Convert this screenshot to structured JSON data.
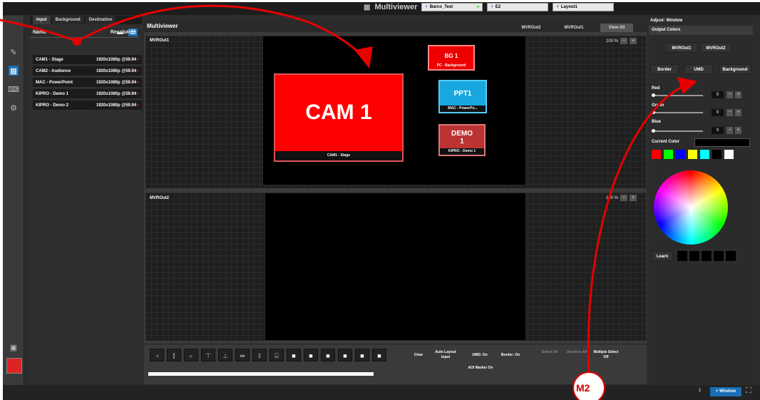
{
  "app": {
    "title": "Multiviewer",
    "destination_preset": "Barco_Test",
    "system": "E2",
    "layout": "Layout1"
  },
  "left_panel": {
    "tabs": [
      "Input",
      "Background",
      "Destination"
    ],
    "header_name": "Name",
    "header_resolution": "Resolution",
    "rows": [
      {
        "name": "CAM1 - Stage",
        "res": "1920x1080p @59.94"
      },
      {
        "name": "CAM2 - Audience",
        "res": "1920x1080p @59.94"
      },
      {
        "name": "MAC - PowerPoint",
        "res": "1920x1080p @59.94"
      },
      {
        "name": "KIPRO - Demo 1",
        "res": "1920x1080p @59.94"
      },
      {
        "name": "KIPRO - Demo 2",
        "res": "1920x1080p @59.94"
      }
    ]
  },
  "center": {
    "title": "Multiviewer",
    "tabs": [
      "MVROut2",
      "MVROut1",
      "View All"
    ],
    "out1_label": "MVROut1",
    "out2_label": "MVROut2",
    "zoom1": "100 %",
    "zoom2": "100 %",
    "windows": {
      "cam1": {
        "title": "CAM 1",
        "label": "CAM1 - Stage"
      },
      "bg1": {
        "title": "BG 1",
        "label": "PC - Background"
      },
      "ppt1": {
        "title": "PPT1",
        "label": "MAC - PowerPo..."
      },
      "demo1": {
        "title": "DEMO 1",
        "label": "KIPRO - Demo 1"
      }
    }
  },
  "toolbar": {
    "clear": "Clear",
    "auto_layout": "Auto Layout Input",
    "umd": "UMD: On",
    "border": "Border: On",
    "aoi": "AOI Marker On",
    "select_all": "Select All",
    "unselect_all": "Unselect All",
    "multiple": "Multiple Select Off"
  },
  "right_panel": {
    "header": "Adjust: Window",
    "section": "Output Colors",
    "out_tabs": [
      "MVROut1",
      "MVROut2"
    ],
    "color_tabs": [
      "Border",
      "UMD",
      "Background"
    ],
    "red_label": "Red",
    "green_label": "Green",
    "blue_label": "Blue",
    "red_value": "0",
    "green_value": "0",
    "blue_value": "0",
    "current_color_label": "Current Color",
    "learn": "Learn",
    "swatches": [
      "#ff0000",
      "#00ff00",
      "#0000ff",
      "#ffff00",
      "#00ffff",
      "#000000",
      "#ffffff"
    ]
  },
  "bottom": {
    "count": "1",
    "window_button": "+ Window"
  },
  "annotation": {
    "marker": "M2"
  }
}
